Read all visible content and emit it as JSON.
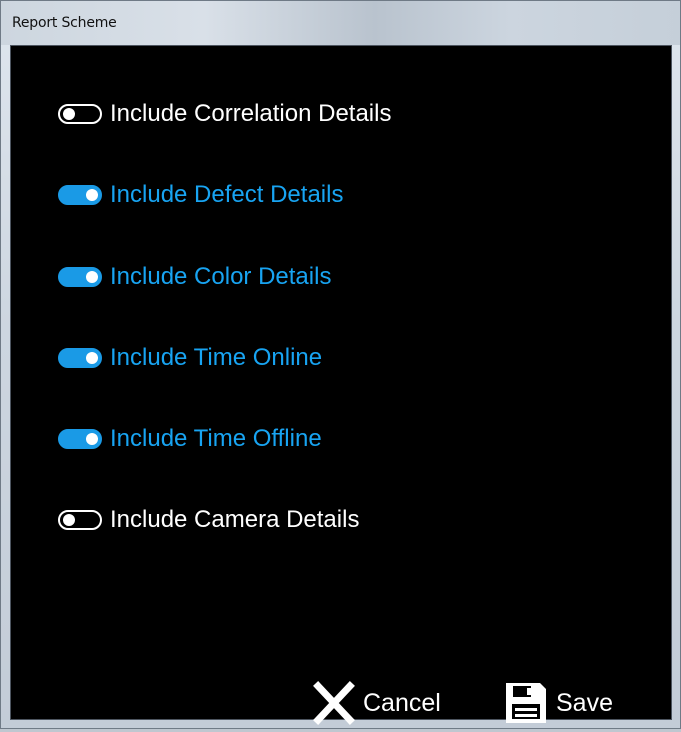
{
  "window": {
    "title": "Report Scheme"
  },
  "options": [
    {
      "label": "Include Correlation Details",
      "enabled": false
    },
    {
      "label": "Include Defect Details",
      "enabled": true
    },
    {
      "label": "Include Color Details",
      "enabled": true
    },
    {
      "label": "Include Time Online",
      "enabled": true
    },
    {
      "label": "Include Time Offline",
      "enabled": true
    },
    {
      "label": "Include Camera Details",
      "enabled": false
    }
  ],
  "actions": {
    "cancel_label": "Cancel",
    "save_label": "Save"
  },
  "icons": {
    "cancel": "close-icon",
    "save": "floppy-disk-icon"
  },
  "colors": {
    "background": "#000000",
    "active_text": "#18a4f2",
    "active_toggle": "#1a9ae6",
    "inactive_text": "#ffffff"
  }
}
